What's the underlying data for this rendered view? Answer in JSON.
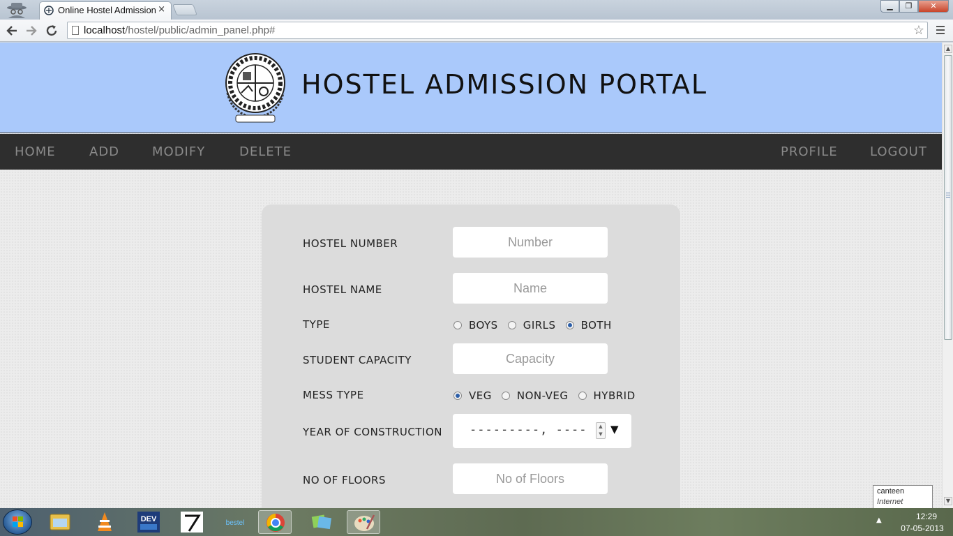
{
  "browser": {
    "tab_title": "Online Hostel Admission S",
    "tab_close": "×",
    "url_host": "localhost",
    "url_path": "/hostel/public/admin_panel.php#",
    "icons": [
      "incognito-icon",
      "back-icon",
      "forward-icon",
      "reload-icon",
      "star-icon",
      "menu-icon"
    ]
  },
  "header": {
    "title": "HOSTEL ADMISSION PORTAL",
    "colors": {
      "band": "#aac9fb",
      "navbar": "#2e2e2e",
      "nav_text": "#8a8a8a"
    }
  },
  "nav": {
    "left": [
      "HOME",
      "ADD",
      "MODIFY",
      "DELETE"
    ],
    "right": [
      "PROFILE",
      "LOGOUT"
    ]
  },
  "form": {
    "hostel_number": {
      "label": "HOSTEL NUMBER",
      "placeholder": "Number"
    },
    "hostel_name": {
      "label": "HOSTEL NAME",
      "placeholder": "Name"
    },
    "type": {
      "label": "TYPE",
      "options": [
        "BOYS",
        "GIRLS",
        "BOTH"
      ],
      "selected": "BOTH"
    },
    "student_capacity": {
      "label": "STUDENT CAPACITY",
      "placeholder": "Capacity"
    },
    "mess_type": {
      "label": "MESS TYPE",
      "options": [
        "VEG",
        "NON-VEG",
        "HYBRID"
      ],
      "selected": "VEG"
    },
    "year_of_construction": {
      "label": "YEAR OF CONSTRUCTION",
      "value": "---------, ----",
      "spin_up": "▲",
      "spin_down": "▼",
      "dropdown": "▼"
    },
    "no_of_floors": {
      "label": "NO OF FLOORS",
      "placeholder": "No of Floors"
    }
  },
  "tooltip": {
    "title": "canteen",
    "subtitle": "Internet access"
  },
  "taskbar": {
    "apps": [
      "file-explorer-icon",
      "vlc-icon",
      "devcpp-icon",
      "app-icon",
      "bestel-icon",
      "chrome-icon",
      "explorer-icon",
      "paint-icon"
    ],
    "bestel_label": "bestel",
    "dev_label": "DEV",
    "time": "12:29",
    "date": "07-05-2013",
    "tray_arrow": "▲"
  }
}
